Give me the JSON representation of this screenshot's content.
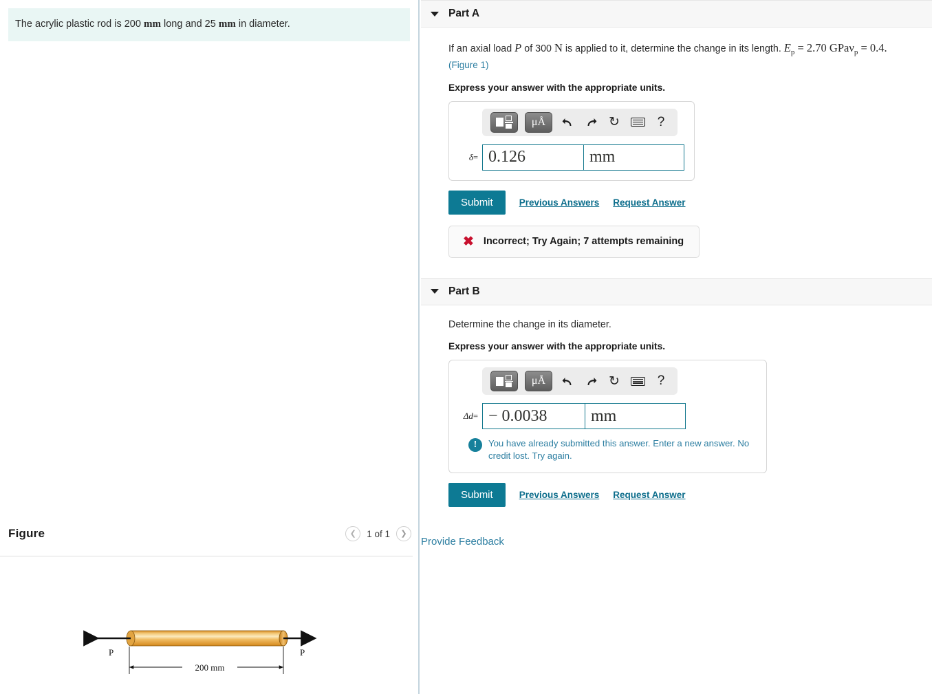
{
  "intro": {
    "text_before": "The acrylic plastic rod is 200 ",
    "unit1": "mm",
    "text_mid": " long and 25 ",
    "unit2": "mm",
    "text_after": " in diameter."
  },
  "figure_panel": {
    "title": "Figure",
    "count_label": "1 of 1",
    "prev_icon": "chevron-left-icon",
    "next_icon": "chevron-right-icon",
    "diagram": {
      "left_load_label": "P",
      "right_load_label": "P",
      "dimension_label": "200 mm",
      "rod_color": "#e8a33d",
      "rod_highlight": "#f7e0a8"
    }
  },
  "toolbar": {
    "buttons": [
      {
        "name": "math-template-button",
        "icon": "fraction-template-icon"
      },
      {
        "name": "units-button",
        "icon": "micro-angstrom-icon",
        "label": "μÅ"
      },
      {
        "name": "undo-button",
        "icon": "undo-arrow-icon",
        "glyph": "⮌"
      },
      {
        "name": "redo-button",
        "icon": "redo-arrow-icon",
        "glyph": "⮍"
      },
      {
        "name": "reset-button",
        "icon": "refresh-icon",
        "glyph": "↻"
      },
      {
        "name": "keyboard-button",
        "icon": "keyboard-icon"
      },
      {
        "name": "help-button",
        "icon": "question-mark-icon",
        "glyph": "?"
      }
    ]
  },
  "part_a": {
    "header": "Part A",
    "question_pre": "If an axial load ",
    "question_P": "P",
    "question_mid": " of 300 ",
    "question_N": "N",
    "question_post": " is applied to it, determine the change in its length. ",
    "modulus": "E",
    "modulus_sub": "p",
    "modulus_val": " = 2.70 GPa",
    "poisson": "ν",
    "poisson_sub": "p",
    "poisson_val": " = 0.4.",
    "figure_ref": "(Figure 1)",
    "express": "Express your answer with the appropriate units.",
    "answer_symbol": "δ",
    "answer_eq": "=",
    "answer_value": "0.126",
    "answer_unit": "mm",
    "submit_label": "Submit",
    "previous_answers_label": "Previous Answers",
    "request_answer_label": "Request Answer",
    "verdict_icon": "x-mark-icon",
    "verdict_text": "Incorrect; Try Again; 7 attempts remaining"
  },
  "part_b": {
    "header": "Part B",
    "question": "Determine the change in its diameter.",
    "express": "Express your answer with the appropriate units.",
    "answer_symbol": "Δd",
    "answer_eq": "=",
    "answer_value": "− 0.0038",
    "answer_unit": "mm",
    "note_icon": "info-exclamation-icon",
    "note_line1": "You have already submitted this answer. Enter a new answer.",
    "note_line2": "No credit lost. Try again.",
    "submit_label": "Submit",
    "previous_answers_label": "Previous Answers",
    "request_answer_label": "Request Answer"
  },
  "footer": {
    "provide_feedback_label": "Provide Feedback"
  },
  "colors": {
    "accent_teal": "#0d7a94",
    "link_blue": "#2c7ea1",
    "banner_bg": "#e9f6f4",
    "error_red": "#c8102e",
    "input_border": "#14788e"
  }
}
